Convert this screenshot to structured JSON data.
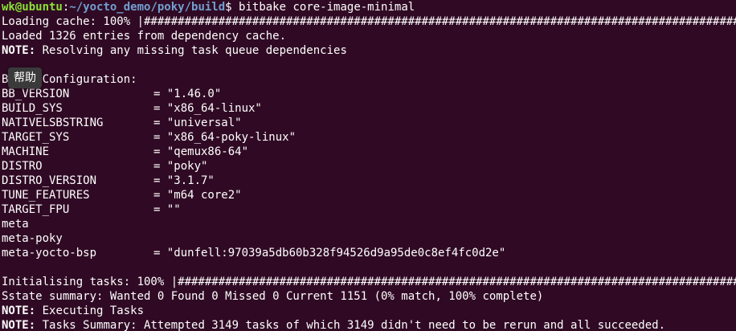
{
  "terminal": {
    "bg_color": "#300a24",
    "prompt": {
      "user_host": "wk@ubuntu",
      "separator": ":",
      "path": "~/yocto_demo/poky/build",
      "symbol": "$",
      "command": " bitbake core-image-minimal"
    },
    "loading_cache": "Loading cache: 100% |##########################################################################################",
    "loaded_entries": "Loaded 1326 entries from dependency cache.",
    "note1_label": "NOTE:",
    "note1_text": " Resolving any missing task queue dependencies",
    "build_config_header": "Build Configuration:",
    "config": [
      {
        "key": "BB_VERSION",
        "value": "= \"1.46.0\""
      },
      {
        "key": "BUILD_SYS",
        "value": "= \"x86_64-linux\""
      },
      {
        "key": "NATIVELSBSTRING",
        "value": "= \"universal\""
      },
      {
        "key": "TARGET_SYS",
        "value": "= \"x86_64-poky-linux\""
      },
      {
        "key": "MACHINE",
        "value": "= \"qemux86-64\""
      },
      {
        "key": "DISTRO",
        "value": "= \"poky\""
      },
      {
        "key": "DISTRO_VERSION",
        "value": "= \"3.1.7\""
      },
      {
        "key": "TUNE_FEATURES",
        "value": "= \"m64 core2\""
      },
      {
        "key": "TARGET_FPU",
        "value": "= \"\""
      }
    ],
    "layer_meta": "meta",
    "layer_meta_poky": "meta-poky",
    "layer_bsp_key": "meta-yocto-bsp",
    "layer_bsp_value": "= \"dunfell:97039a5db60b328f94526d9a95de0c8ef4fc0d2e\"",
    "init_tasks": "Initialising tasks: 100% |##########################################################################################",
    "sstate_summary": "Sstate summary: Wanted 0 Found 0 Missed 0 Current 1151 (0% match, 100% complete)",
    "note2_label": "NOTE:",
    "note2_text": " Executing Tasks",
    "note3_label": "NOTE:",
    "note3_text": " Tasks Summary: Attempted 3149 tasks of which 3149 didn't need to be rerun and all succeeded."
  },
  "tooltip": {
    "text": "帮助"
  }
}
